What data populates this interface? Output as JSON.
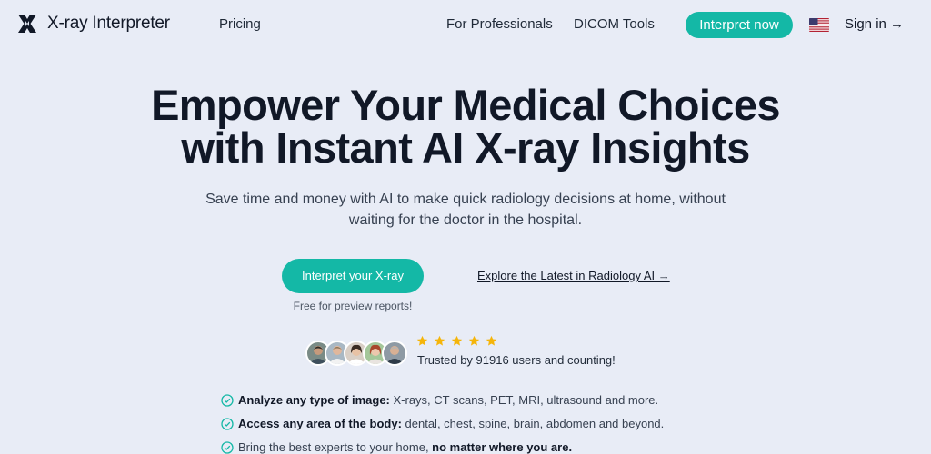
{
  "nav": {
    "brand": "X-ray Interpreter",
    "pricing": "Pricing",
    "professionals": "For Professionals",
    "dicom": "DICOM Tools",
    "cta": "Interpret now",
    "flag_icon": "us-flag-icon",
    "signin": "Sign in →"
  },
  "hero": {
    "title_line1": "Empower Your Medical Choices",
    "title_line2": "with Instant AI X-ray Insights",
    "subtitle": "Save time and money with AI to make quick radiology decisions at home, without waiting for the doctor in the hospital.",
    "cta": "Interpret your X-ray",
    "cta_note": "Free for preview reports!",
    "explore": "Explore the Latest in Radiology AI →"
  },
  "trust": {
    "rating": 5,
    "text": "Trusted by 91916 users and counting!"
  },
  "features": [
    {
      "bold": "Analyze any type of image:",
      "text": " X-rays, CT scans, PET, MRI, ultrasound and more."
    },
    {
      "bold": "Access any area of the body:",
      "text": " dental, chest, spine, brain, abdomen and beyond."
    },
    {
      "pre": "Bring the best experts to your home, ",
      "bold": "no matter where you are."
    }
  ],
  "colors": {
    "background": "#e8ecf6",
    "accent": "#14b8a6",
    "star": "#f5b50a",
    "text": "#111827"
  }
}
